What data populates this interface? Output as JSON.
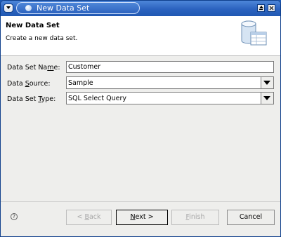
{
  "window": {
    "title": "New Data Set"
  },
  "header": {
    "title": "New Data Set",
    "description": "Create a new data set.",
    "icon": "database-icon"
  },
  "form": {
    "name": {
      "label_before": "Data Set Na",
      "label_mnemonic": "m",
      "label_after": "e:",
      "value": "Customer"
    },
    "source": {
      "label_before": "Data ",
      "label_mnemonic": "S",
      "label_after": "ource:",
      "value": "Sample"
    },
    "type": {
      "label_before": "Data Set ",
      "label_mnemonic": "T",
      "label_after": "ype:",
      "value": "SQL Select Query"
    }
  },
  "footer": {
    "help_icon_glyph": "?",
    "back_before": "< ",
    "back_mnemonic": "B",
    "back_after": "ack",
    "next_mnemonic": "N",
    "next_after": "ext >",
    "finish_mnemonic": "F",
    "finish_after": "inish",
    "cancel_label": "Cancel"
  },
  "colors": {
    "titlebar": "#2b62bf",
    "window_bg": "#eeeeec",
    "header_bg": "#ffffff"
  }
}
